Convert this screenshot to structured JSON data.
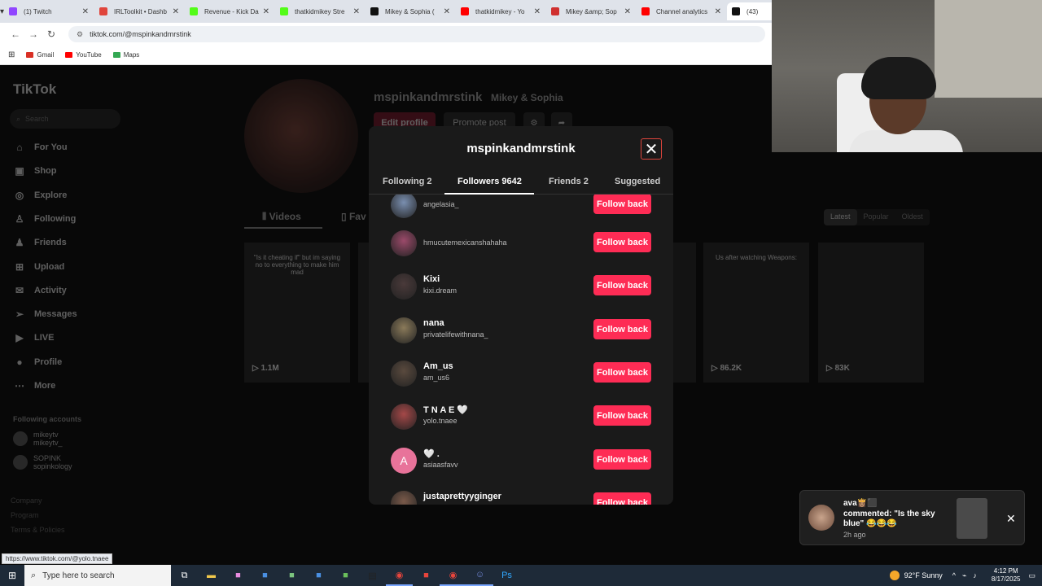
{
  "browser": {
    "tabs": [
      {
        "title": "(1) Twitch",
        "color": "#9146ff",
        "active": false
      },
      {
        "title": "IRLToolkit • Dashb",
        "color": "#e0453c",
        "active": false
      },
      {
        "title": "Revenue - Kick Da",
        "color": "#53fc18",
        "active": false
      },
      {
        "title": "thatkidmikey Stre",
        "color": "#53fc18",
        "active": false
      },
      {
        "title": "Mikey & Sophia (",
        "color": "#111111",
        "active": false
      },
      {
        "title": "thatkidmikey - Yo",
        "color": "#ff0000",
        "active": false
      },
      {
        "title": "Mikey &amp; Sop",
        "color": "#d0302f",
        "active": false
      },
      {
        "title": "Channel analytics",
        "color": "#ff0000",
        "active": false
      },
      {
        "title": "(43)",
        "color": "#111111",
        "active": true
      }
    ],
    "url": "tiktok.com/@mspinkandmrstink",
    "bookmarks": [
      {
        "label": "Gmail",
        "color": "#d93025"
      },
      {
        "label": "YouTube",
        "color": "#ff0000"
      },
      {
        "label": "Maps",
        "color": "#34a853"
      }
    ]
  },
  "sidebar": {
    "logo": "TikTok",
    "search_placeholder": "Search",
    "nav": [
      {
        "label": "For You",
        "icon": "home-icon",
        "glyph": "⌂"
      },
      {
        "label": "Shop",
        "icon": "shop-icon",
        "glyph": "▣"
      },
      {
        "label": "Explore",
        "icon": "compass-icon",
        "glyph": "◎"
      },
      {
        "label": "Following",
        "icon": "following-icon",
        "glyph": "♙"
      },
      {
        "label": "Friends",
        "icon": "friends-icon",
        "glyph": "♟"
      },
      {
        "label": "Upload",
        "icon": "upload-icon",
        "glyph": "⊞"
      },
      {
        "label": "Activity",
        "icon": "activity-icon",
        "glyph": "✉"
      },
      {
        "label": "Messages",
        "icon": "messages-icon",
        "glyph": "➢"
      },
      {
        "label": "LIVE",
        "icon": "live-icon",
        "glyph": "▶"
      },
      {
        "label": "Profile",
        "icon": "profile-icon",
        "glyph": "●"
      },
      {
        "label": "More",
        "icon": "more-icon",
        "glyph": "⋯"
      }
    ],
    "following_heading": "Following accounts",
    "following": [
      {
        "name": "mikeytv",
        "handle": "mikeytv_"
      },
      {
        "name": "SOPINK",
        "handle": "sopinkology"
      }
    ],
    "footer": [
      "Company",
      "Program",
      "Terms & Policies"
    ]
  },
  "profile": {
    "username": "mspinkandmrstink",
    "display_name": "Mikey & Sophia",
    "edit_label": "Edit profile",
    "promote_label": "Promote post",
    "tab_videos": "Videos",
    "tab_favorites": "Fav",
    "sort": [
      "Latest",
      "Popular",
      "Oldest"
    ],
    "thumbs": [
      {
        "caption": "\"Is it cheating if\" but im saying no to everything to make him mad",
        "views": "1.1M"
      },
      {
        "caption": "",
        "views": ""
      },
      {
        "caption": "",
        "views": ""
      },
      {
        "caption": "Us after watching Weapons:",
        "views": "86.2K"
      },
      {
        "caption": "",
        "views": "83K"
      }
    ]
  },
  "modal": {
    "title": "mspinkandmrstink",
    "tabs": [
      {
        "label": "Following 2",
        "active": false
      },
      {
        "label": "Followers 9642",
        "active": true
      },
      {
        "label": "Friends 2",
        "active": false
      },
      {
        "label": "Suggested",
        "active": false
      }
    ],
    "rows": [
      {
        "name": "",
        "handle": "angelasia_",
        "button": "Follow back",
        "avatar": "#7a8fb0",
        "letter": ""
      },
      {
        "name": "",
        "handle": "hmucutemexicanshahaha",
        "button": "Follow back",
        "avatar": "#9b4a6a",
        "letter": ""
      },
      {
        "name": "Kixi",
        "handle": "kixi.dream",
        "button": "Follow back",
        "avatar": "#4a3a3a",
        "letter": ""
      },
      {
        "name": "nana",
        "handle": "privatelifewithnana_",
        "button": "Follow back",
        "avatar": "#8a7a5a",
        "letter": ""
      },
      {
        "name": "Am_us",
        "handle": "am_us6",
        "button": "Follow back",
        "avatar": "#5a4a3e",
        "letter": ""
      },
      {
        "name": "T N A E 🤍",
        "handle": "yolo.tnaee",
        "button": "Follow back",
        "avatar": "#a54848",
        "letter": ""
      },
      {
        "name": "🤍 .",
        "handle": "asiaasfavv",
        "button": "Follow back",
        "avatar": "#e8739a",
        "letter": "A"
      },
      {
        "name": "justaprettyyginger",
        "handle": "",
        "button": "Follow back",
        "avatar": "#7a5a4a",
        "letter": ""
      }
    ]
  },
  "notification": {
    "user": "ava👸🏽⬛",
    "text": "commented: \"Is the sky blue\" 😂😂😂",
    "ago": "2h ago"
  },
  "status_url": "https://www.tiktok.com/@yolo.tnaee",
  "taskbar": {
    "search_placeholder": "Type here to search",
    "weather": "92°F  Sunny",
    "time": "4:12 PM",
    "date": "8/17/2025",
    "apps": [
      "task-view-icon",
      "file-explorer-icon",
      "app-icon",
      "app-icon",
      "app-icon",
      "app-icon",
      "app-icon",
      "pdf-icon",
      "chrome-icon",
      "app-icon",
      "chrome-icon",
      "discord-icon",
      "photoshop-icon"
    ]
  }
}
